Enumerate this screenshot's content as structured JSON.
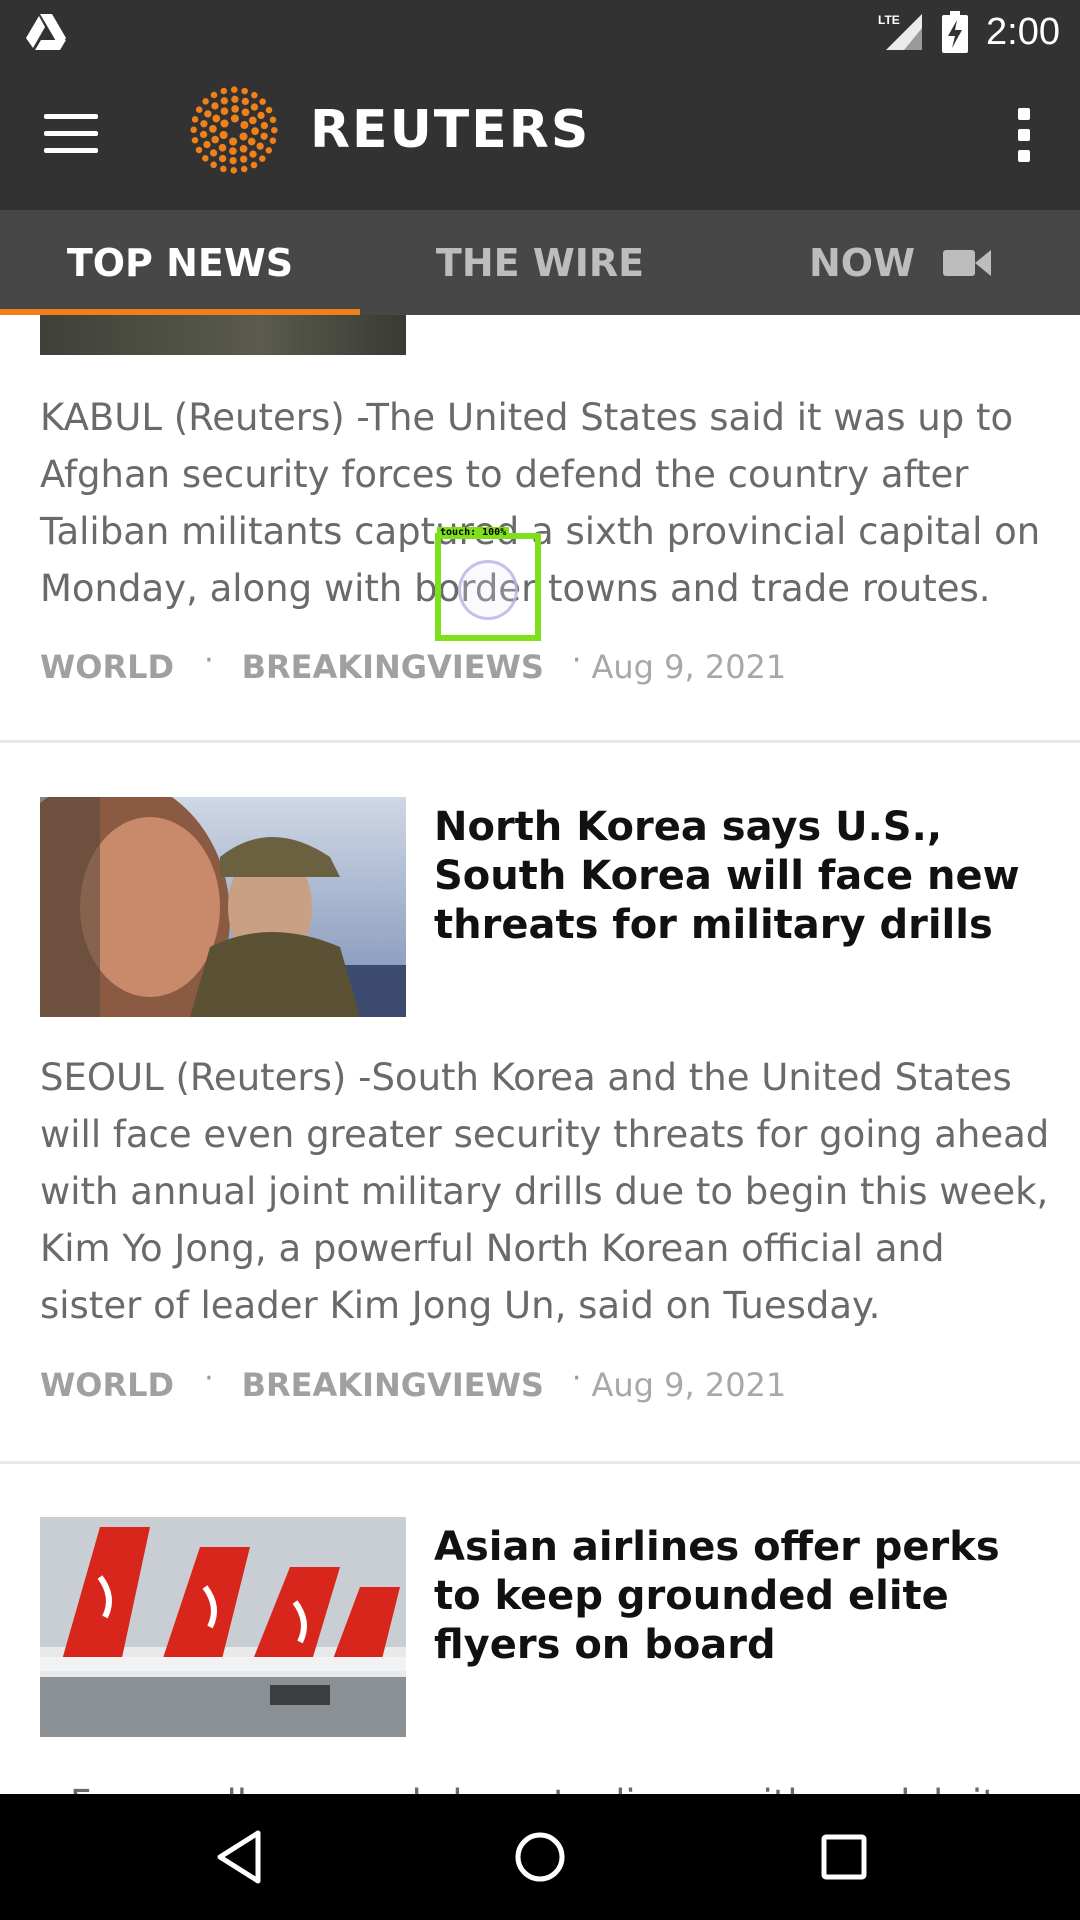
{
  "status_bar": {
    "network": "LTE",
    "time": "2:00",
    "icons": [
      "drive-icon",
      "signal-icon",
      "battery-charging-icon"
    ]
  },
  "app_bar": {
    "logo_text": "REUTERS",
    "menu_icon": "hamburger-menu-icon",
    "overflow_icon": "more-vert-icon",
    "brand_color": "#F0801A"
  },
  "tabs": [
    {
      "label": "TOP NEWS",
      "active": true
    },
    {
      "label": "THE WIRE",
      "active": false
    },
    {
      "label": "NOW",
      "active": false,
      "icon": "video-camera-icon"
    }
  ],
  "articles": [
    {
      "headline": "",
      "summary": "KABUL (Reuters) -The United States said it was up to Afghan security forces to defend the country after Taliban militants captured a sixth provincial capital on Monday, along with border towns and trade routes.",
      "category": "WORLD",
      "tag": "BREAKINGVIEWS",
      "date": "Aug 9, 2021"
    },
    {
      "headline": "North Korea says U.S., South Korea will face new threats for military drills",
      "summary": "SEOUL (Reuters) -South Korea and the United States will face even greater security threats for going ahead with annual joint military drills due to begin this week, Kim Yo Jong, a powerful North Korean official and sister of leader Kim Jong Un, said on Tuesday.",
      "category": "WORLD",
      "tag": "BREAKINGVIEWS",
      "date": "Aug 9, 2021"
    },
    {
      "headline": "Asian airlines offer perks to keep grounded elite flyers on board",
      "summary": "From wellness workshops to dinner with a celebrity",
      "category": "",
      "tag": "",
      "date": ""
    }
  ],
  "touch_overlay": {
    "label": "touch: 100%"
  },
  "nav_bar": {
    "icons": [
      "back-icon",
      "home-icon",
      "recents-icon"
    ]
  }
}
